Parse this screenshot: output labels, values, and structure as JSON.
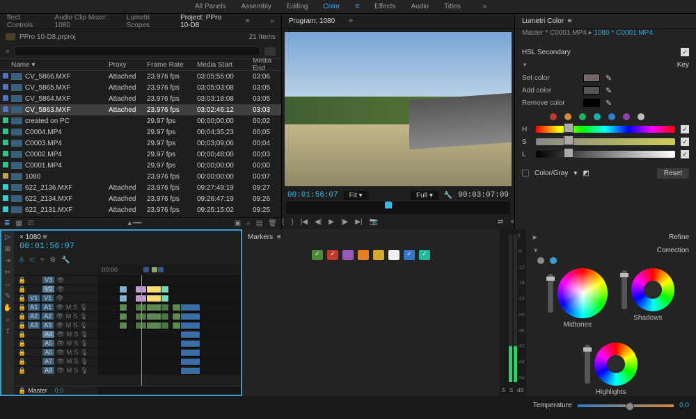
{
  "topmenu": {
    "items": [
      "All Panels",
      "Assembly",
      "Editing",
      "Color",
      "Effects",
      "Audio",
      "Titles"
    ],
    "active": "Color"
  },
  "panels": {
    "left_tabs": [
      "ffect Controls",
      "Audio Clip Mixer: 1080",
      "Lumetri Scopes",
      "Project: PPro 10-D8"
    ],
    "left_active": "Project: PPro 10-D8"
  },
  "project": {
    "file": "PPro 10-D8.prproj",
    "item_count": "21 Items",
    "columns": [
      "Name",
      "Proxy",
      "Frame Rate",
      "Media Start",
      "Media End"
    ],
    "rows": [
      {
        "chip": "#5670c8",
        "name": "CV_5866.MXF",
        "proxy": "Attached",
        "fps": "23.976 fps",
        "start": "03:05:55:00",
        "end": "03:06"
      },
      {
        "chip": "#5670c8",
        "name": "CV_5865.MXF",
        "proxy": "Attached",
        "fps": "23.976 fps",
        "start": "03:05:03:08",
        "end": "03:05"
      },
      {
        "chip": "#5670c8",
        "name": "CV_5864.MXF",
        "proxy": "Attached",
        "fps": "23.976 fps",
        "start": "03:03:18:08",
        "end": "03:05"
      },
      {
        "chip": "#5670c8",
        "name": "CV_5863.MXF",
        "proxy": "Attached",
        "fps": "23.976 fps",
        "start": "03:02:46:12",
        "end": "03:03",
        "sel": true
      },
      {
        "chip": "#36c28c",
        "name": "created on PC",
        "proxy": "",
        "fps": "29.97 fps",
        "start": "00;00;00;00",
        "end": "00;02"
      },
      {
        "chip": "#36c28c",
        "name": "C0004.MP4",
        "proxy": "",
        "fps": "29.97 fps",
        "start": "00;04;35;23",
        "end": "00;05"
      },
      {
        "chip": "#36c28c",
        "name": "C0003.MP4",
        "proxy": "",
        "fps": "29.97 fps",
        "start": "00;03;09;06",
        "end": "00;04"
      },
      {
        "chip": "#36c28c",
        "name": "C0002.MP4",
        "proxy": "",
        "fps": "29.97 fps",
        "start": "00;00;48;00",
        "end": "00;03"
      },
      {
        "chip": "#36c28c",
        "name": "C0001.MP4",
        "proxy": "",
        "fps": "29.97 fps",
        "start": "00;00;00;00",
        "end": "00;00"
      },
      {
        "chip": "#bca24a",
        "name": "1080",
        "proxy": "",
        "fps": "23.976 fps",
        "start": "00:00:00:00",
        "end": "00:07"
      },
      {
        "chip": "#2ed0d0",
        "name": "622_2136.MXF",
        "proxy": "Attached",
        "fps": "23.976 fps",
        "start": "09:27:49:19",
        "end": "09:27"
      },
      {
        "chip": "#2ed0d0",
        "name": "622_2134.MXF",
        "proxy": "Attached",
        "fps": "23.976 fps",
        "start": "09:26:47:19",
        "end": "09:26"
      },
      {
        "chip": "#2ed0d0",
        "name": "622_2131.MXF",
        "proxy": "Attached",
        "fps": "23.976 fps",
        "start": "09:25:15:02",
        "end": "09:25"
      }
    ]
  },
  "program": {
    "title": "Program: 1080",
    "tc_left": "00:01:56:07",
    "fit": "Fit",
    "full": "Full",
    "tc_right": "00:03:07:09"
  },
  "lumetri": {
    "title": "Lumetri Color",
    "master": "Master * C0001.MP4",
    "clip": "1080 * C0001.MP4",
    "hsl_secondary": "HSL Secondary",
    "key": "Key",
    "set_color": "Set color",
    "add_color": "Add color",
    "remove_color": "Remove color",
    "dot_colors": [
      "#c0392b",
      "#d68a3a",
      "#27ae60",
      "#14b1b1",
      "#2a7fd4",
      "#8e44ad",
      "#bbb"
    ],
    "hsl_labels": [
      "H",
      "S",
      "L"
    ],
    "colorgray": "Color/Gray",
    "reset": "Reset",
    "refine": "Refine",
    "correction": "Correction",
    "wheels": {
      "mid": "Midtones",
      "shad": "Shadows",
      "high": "Highlights"
    },
    "temperature": "Temperature",
    "temp_val": "0.0"
  },
  "timeline": {
    "title": "1080",
    "tc": "00:01:56:07",
    "ruler_start": ":00:00",
    "master": "Master",
    "master_val": "0.0",
    "tracks": [
      {
        "id": "V3",
        "type": "v"
      },
      {
        "id": "V2",
        "type": "v",
        "sel": true
      },
      {
        "id": "V1",
        "type": "v",
        "src": "V1"
      },
      {
        "id": "A1",
        "type": "a",
        "src": "A1"
      },
      {
        "id": "A2",
        "type": "a",
        "src": "A2"
      },
      {
        "id": "A3",
        "type": "a",
        "src": "A3"
      },
      {
        "id": "A4",
        "type": "a",
        "sel": true
      },
      {
        "id": "A5",
        "type": "a"
      },
      {
        "id": "A6",
        "type": "a"
      },
      {
        "id": "A7",
        "type": "a"
      },
      {
        "id": "A8",
        "type": "a"
      }
    ]
  },
  "markers": {
    "title": "Markers",
    "chips": [
      "#4a8a3a",
      "#c0392b",
      "#9b59b6",
      "#e67e22",
      "#d4a82a",
      "#eee",
      "#3478c7",
      "#1abc9c"
    ]
  },
  "meters": {
    "scale": [
      "0",
      "-6",
      "-12",
      "-18",
      "-24",
      "-30",
      "-36",
      "-42",
      "-48",
      "-54"
    ],
    "labels": [
      "S",
      "S",
      "dB"
    ]
  }
}
